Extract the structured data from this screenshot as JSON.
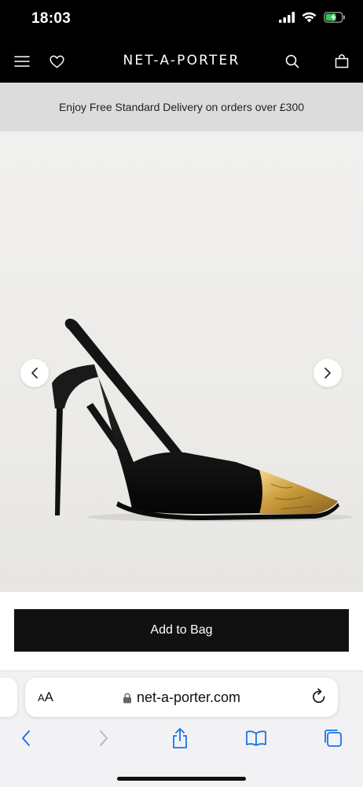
{
  "status_bar": {
    "time": "18:03"
  },
  "nav": {
    "logo": "NET-A-PORTER"
  },
  "promo": {
    "text": "Enjoy Free Standard Delivery on orders over £300"
  },
  "product": {
    "image_alt": "black slingback pump with gold toe cap"
  },
  "actions": {
    "add_to_bag_label": "Add to Bag"
  },
  "browser": {
    "aa_label_big": "A",
    "aa_label_small": "A",
    "url": "net-a-porter.com"
  },
  "colors": {
    "nav_bg": "#000000",
    "promo_bg": "#dcdcdc",
    "button_bg": "#111111",
    "safari_accent": "#1a73e8"
  }
}
